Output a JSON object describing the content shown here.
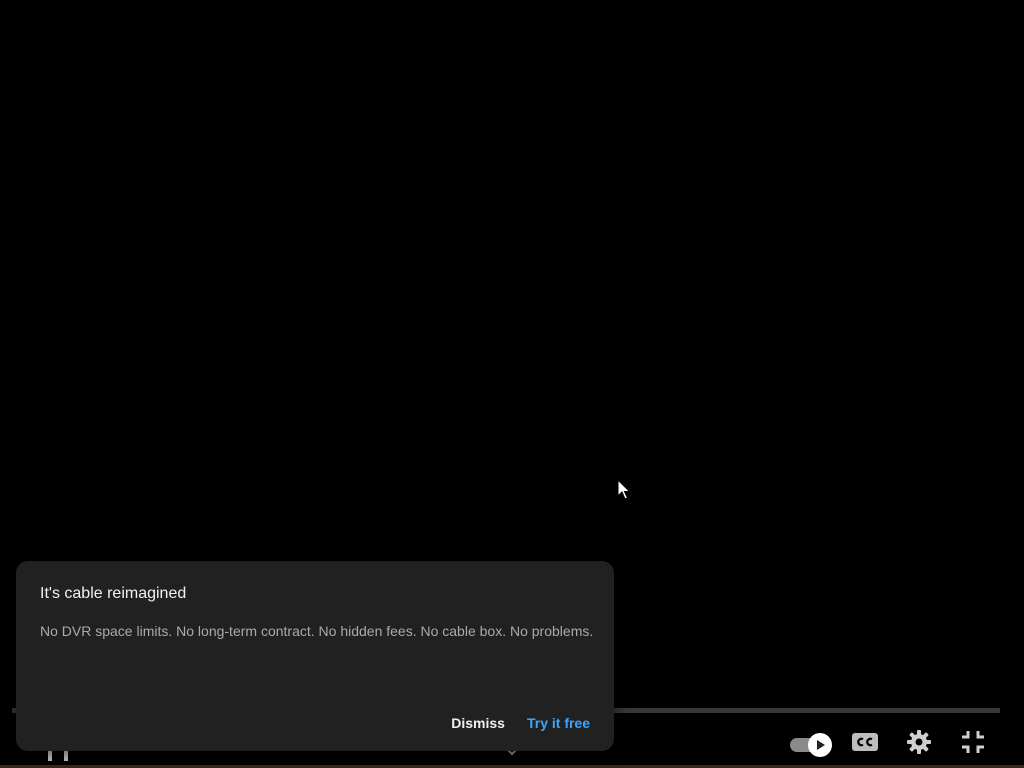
{
  "promo": {
    "title": "It's cable reimagined",
    "body": "No DVR space limits. No long-term contract. No hidden fees. No cable box. No problems.",
    "dismiss_label": "Dismiss",
    "try_label": "Try it free"
  },
  "player": {
    "autoplay_on": true,
    "icons": [
      "autoplay-toggle-icon",
      "closed-captions-icon",
      "settings-gear-icon",
      "exit-fullscreen-icon",
      "chevron-down-icon"
    ]
  },
  "colors": {
    "background": "#000000",
    "dialog": "#212121",
    "accent": "#3ea6ff",
    "text_primary": "#f1f1f1",
    "text_secondary": "#aaaaaa"
  }
}
